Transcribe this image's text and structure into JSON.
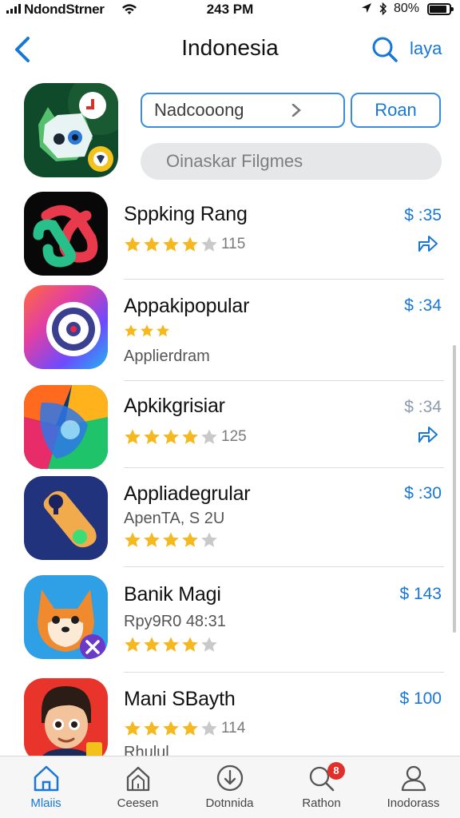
{
  "status_bar": {
    "carrier": "NdondStrner",
    "time": "243 PM",
    "battery": "80%"
  },
  "nav": {
    "title": "Indonesia",
    "right_link": "laya"
  },
  "featured": {
    "store_field": "Nadcooong",
    "run_button": "Roan",
    "filter_pill": "Oinaskar Filgmes"
  },
  "apps": [
    {
      "name": "Sppking Rang",
      "price": "$ :35",
      "rating": "115",
      "stars": 4
    },
    {
      "name": "Appakipopular",
      "price": "$ :34",
      "subtitle": "Applierdram",
      "stars": 3
    },
    {
      "name": "Apkikgrisiar",
      "price": "$ :34",
      "rating": "125",
      "stars": 4
    },
    {
      "name": "Appliadegrular",
      "price": "$ :30",
      "subtitle": "ApenTA, S 2U",
      "stars": 4
    },
    {
      "name": "Banik Magi",
      "price": "$ 143",
      "subtitle": "Rpy9R0 48:31",
      "stars": 4
    },
    {
      "name": "Mani SBayth",
      "price": "$ 100",
      "rating": "114",
      "subtitle": "Rhulul",
      "stars": 4
    }
  ],
  "tabbar": {
    "tabs": [
      {
        "label": "Mlaiis",
        "icon": "home-icon"
      },
      {
        "label": "Ceesen",
        "icon": "store-icon"
      },
      {
        "label": "Dotnnida",
        "icon": "download-icon"
      },
      {
        "label": "Rathon",
        "icon": "search-icon",
        "badge": "8"
      },
      {
        "label": "Inodorass",
        "icon": "profile-icon"
      }
    ]
  },
  "colors": {
    "accent": "#1877d6",
    "star": "#f5b91f",
    "badge": "#e0302c"
  }
}
